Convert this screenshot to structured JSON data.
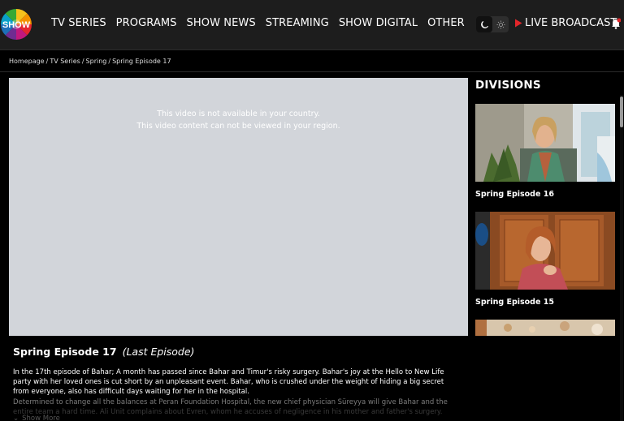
{
  "header": {
    "logo_text": "SHOW",
    "nav": [
      {
        "label": "TV SERIES"
      },
      {
        "label": "PROGRAMS"
      },
      {
        "label": "SHOW NEWS"
      },
      {
        "label": "STREAMING"
      },
      {
        "label": "SHOW DIGITAL"
      },
      {
        "label": "OTHER"
      }
    ],
    "theme_toggle": {
      "options": [
        "moon-icon",
        "sun-icon"
      ],
      "active": "dark"
    },
    "live_label": "LIVE BROADCAST",
    "notification_icon": "bell-icon",
    "colors": {
      "background": "#1d1d1d",
      "live_accent": "#e3262a"
    }
  },
  "breadcrumb": {
    "items": [
      "Homepage",
      "TV Series",
      "Spring",
      "Spring Episode 17"
    ],
    "separator": "/"
  },
  "player": {
    "message_line1": "This video is not available in your country.",
    "message_line2": "This video content can not be viewed in your region.",
    "background_color": "#d2d5da"
  },
  "episode": {
    "title": "Spring Episode 17",
    "badge": "(Last Episode)",
    "description_1": "In the 17th episode of Bahar; A month has passed since Bahar and Timur's risky surgery. Bahar's joy at the Hello to New Life party with her loved ones is cut short by an unpleasant event. Bahar, who is crushed under the weight of hiding a big secret from everyone, also has difficult days waiting for her in the hospital.",
    "description_2": "Determined to change all the balances at Peran Foundation Hospital, the new chief physician Süreyya will give Bahar and the",
    "description_3": "entire team a hard time. Ali Unit complains about Evren, whom he accuses of negligence in his mother and father's surgery.",
    "show_more_label": "Show More",
    "show_more_icon": "chevron-down-icon"
  },
  "sidebar": {
    "title": "DIVISIONS",
    "cards": [
      {
        "title": "Spring Episode 16"
      },
      {
        "title": "Spring Episode 15"
      },
      {
        "title": ""
      }
    ]
  }
}
